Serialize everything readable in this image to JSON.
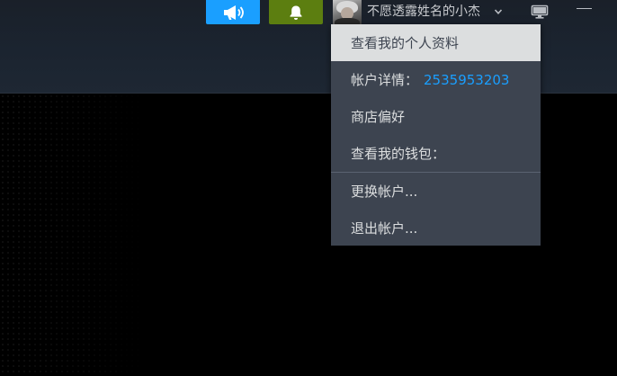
{
  "header": {
    "username": "不愿透露姓名的小杰",
    "buttons": {
      "announce_icon": "megaphone-icon",
      "notify_icon": "bell-icon",
      "monitor_icon": "monitor-icon",
      "minimize_icon": "minimize-icon",
      "caret_icon": "chevron-down-icon"
    },
    "colors": {
      "announce_bg": "#1a9fff",
      "notify_bg": "#5c7e10",
      "bar_bg": "#1b2430"
    }
  },
  "account_menu": {
    "items": [
      {
        "label": "查看我的个人资料"
      },
      {
        "label": "帐户详情：",
        "value": "2535953203"
      },
      {
        "label": "商店偏好"
      },
      {
        "label": "查看我的钱包："
      },
      {
        "label": "更换帐户..."
      },
      {
        "label": "退出帐户..."
      }
    ],
    "colors": {
      "bg": "#3d4450",
      "highlight_bg": "#dcdedf",
      "link": "#1a9fff"
    }
  }
}
